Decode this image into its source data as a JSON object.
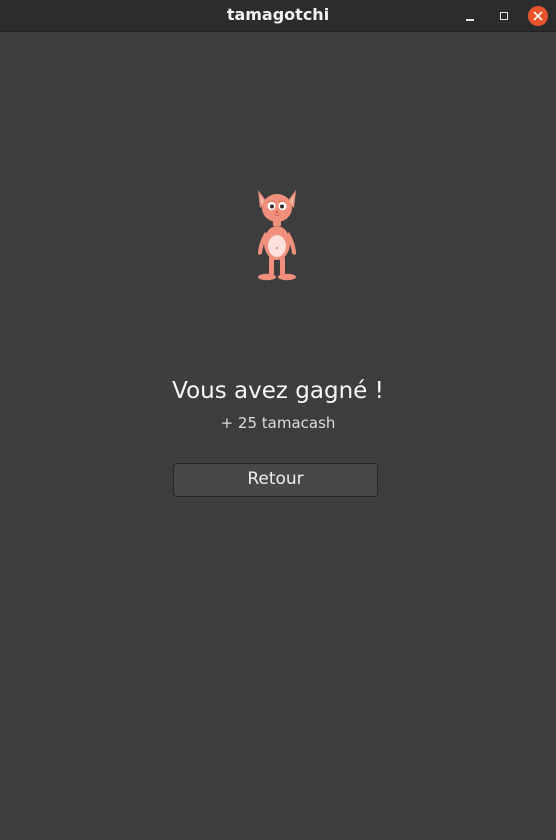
{
  "window": {
    "title": "tamagotchi",
    "controls": {
      "minimize_icon": "minimize-icon",
      "maximize_icon": "maximize-icon",
      "close_icon": "close-icon",
      "close_color": "#e9542a"
    }
  },
  "result": {
    "pet_icon": "pink-creature",
    "heading": "Vous avez gagné !",
    "reward": "+ 25 tamacash",
    "back_button": "Retour"
  },
  "colors": {
    "background": "#3d3d3d",
    "titlebar": "#2c2c2c",
    "pet": "#f0907c",
    "pet_belly": "#fbe0dc"
  }
}
